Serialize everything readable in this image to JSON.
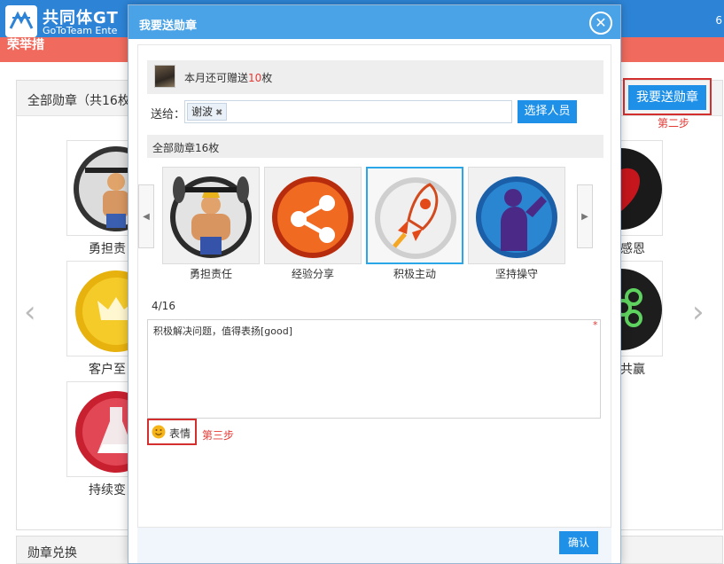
{
  "app": {
    "brand": "共同体GT",
    "brand_sub": "GoToTeam Ente",
    "salmon_text": "荣举措",
    "corner": "6"
  },
  "background": {
    "panel_title": "全部勋章（共16枚",
    "send_button": "我要送勋章",
    "step2": "第二步",
    "exchange_label": "勋章兑换",
    "badge_labels": [
      "勇担责",
      "客户至",
      "持续变",
      "感恩",
      "共赢"
    ]
  },
  "dialog": {
    "title": "我要送勋章",
    "info_prefix": "本月还可赠送",
    "info_count": "10",
    "info_suffix": "枚",
    "send_to_label": "送给：",
    "recipient": "谢波",
    "choose_button": "选择人员",
    "all_badges_prefix": "全部勋章",
    "all_badges_count": "16枚",
    "badges": [
      {
        "label": "勇担责任",
        "icon": "weightlifter-icon"
      },
      {
        "label": "经验分享",
        "icon": "share-icon"
      },
      {
        "label": "积极主动",
        "icon": "rocket-icon"
      },
      {
        "label": "坚持操守",
        "icon": "worker-icon"
      }
    ],
    "selected_index": 2,
    "counter": "4/16",
    "message": "积极解决问题，值得表扬[good]",
    "required_mark": "*",
    "emoji_label": "表情",
    "step3": "第三步",
    "confirm": "确认"
  },
  "colors": {
    "header_blue": "#2d84d6",
    "salmon": "#f06b5e",
    "accent_blue": "#1e90e8",
    "highlight_red": "#d32f2f",
    "selected_border": "#2aa7e8"
  }
}
